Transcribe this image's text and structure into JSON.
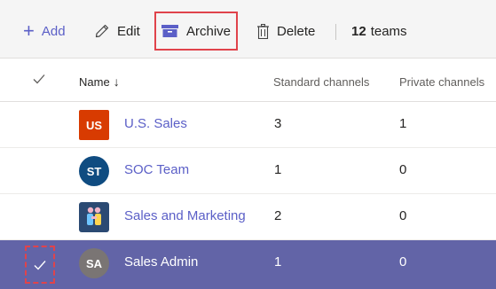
{
  "toolbar": {
    "add_label": "Add",
    "edit_label": "Edit",
    "archive_label": "Archive",
    "delete_label": "Delete",
    "count_number": "12",
    "count_text": "teams"
  },
  "table": {
    "headers": {
      "name": "Name",
      "name_sort_icon": "arrow-down-icon",
      "standard_channels": "Standard channels",
      "private_channels": "Private channels"
    },
    "rows": [
      {
        "avatar_text": "US",
        "avatar_color": "#d83b01",
        "name": "U.S. Sales",
        "standard": "3",
        "private": "1",
        "selected": false
      },
      {
        "avatar_text": "ST",
        "avatar_color": "#0f4c81",
        "name": "SOC Team",
        "standard": "1",
        "private": "0",
        "selected": false
      },
      {
        "avatar_text": "",
        "avatar_color": "#2b4a73",
        "name": "Sales and Marketing",
        "standard": "2",
        "private": "0",
        "selected": false
      },
      {
        "avatar_text": "SA",
        "avatar_color": "#7a7574",
        "name": "Sales Admin",
        "standard": "1",
        "private": "0",
        "selected": true
      }
    ]
  },
  "colors": {
    "accent": "#5b5fc7",
    "selected_row": "#6264a7",
    "highlight_border": "#e0434b"
  }
}
